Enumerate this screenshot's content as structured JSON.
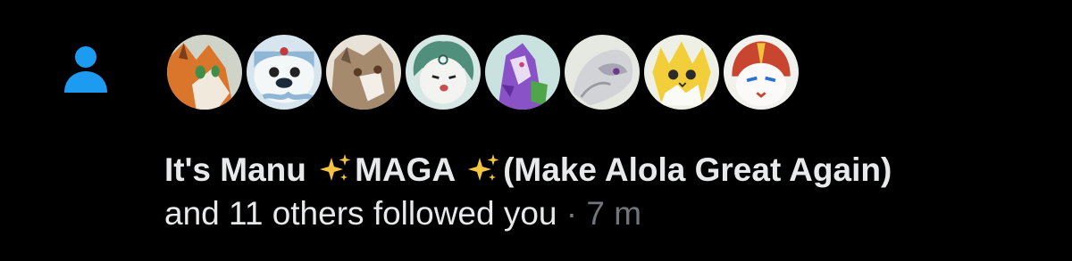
{
  "notification": {
    "type_icon": "person-icon",
    "icon_color": "#1d9bf0",
    "avatars": [
      {
        "icon": "avatar-orange-fox"
      },
      {
        "icon": "avatar-blue-otter"
      },
      {
        "icon": "avatar-brown-wolf"
      },
      {
        "icon": "avatar-green-white-singer"
      },
      {
        "icon": "avatar-purple-dragon"
      },
      {
        "icon": "avatar-grey-psychic"
      },
      {
        "icon": "avatar-yellow-electric"
      },
      {
        "icon": "avatar-red-white-fighter"
      }
    ],
    "name_part1": "It's Manu ",
    "name_part2": "MAGA ",
    "name_part3": "(Make Alola Great Again)",
    "action": " and 11 others followed you",
    "separator": " · ",
    "time": "7 m",
    "colors": {
      "text": "#e7e9ea",
      "meta": "#71767b",
      "background": "#000000",
      "accent": "#1d9bf0"
    }
  }
}
